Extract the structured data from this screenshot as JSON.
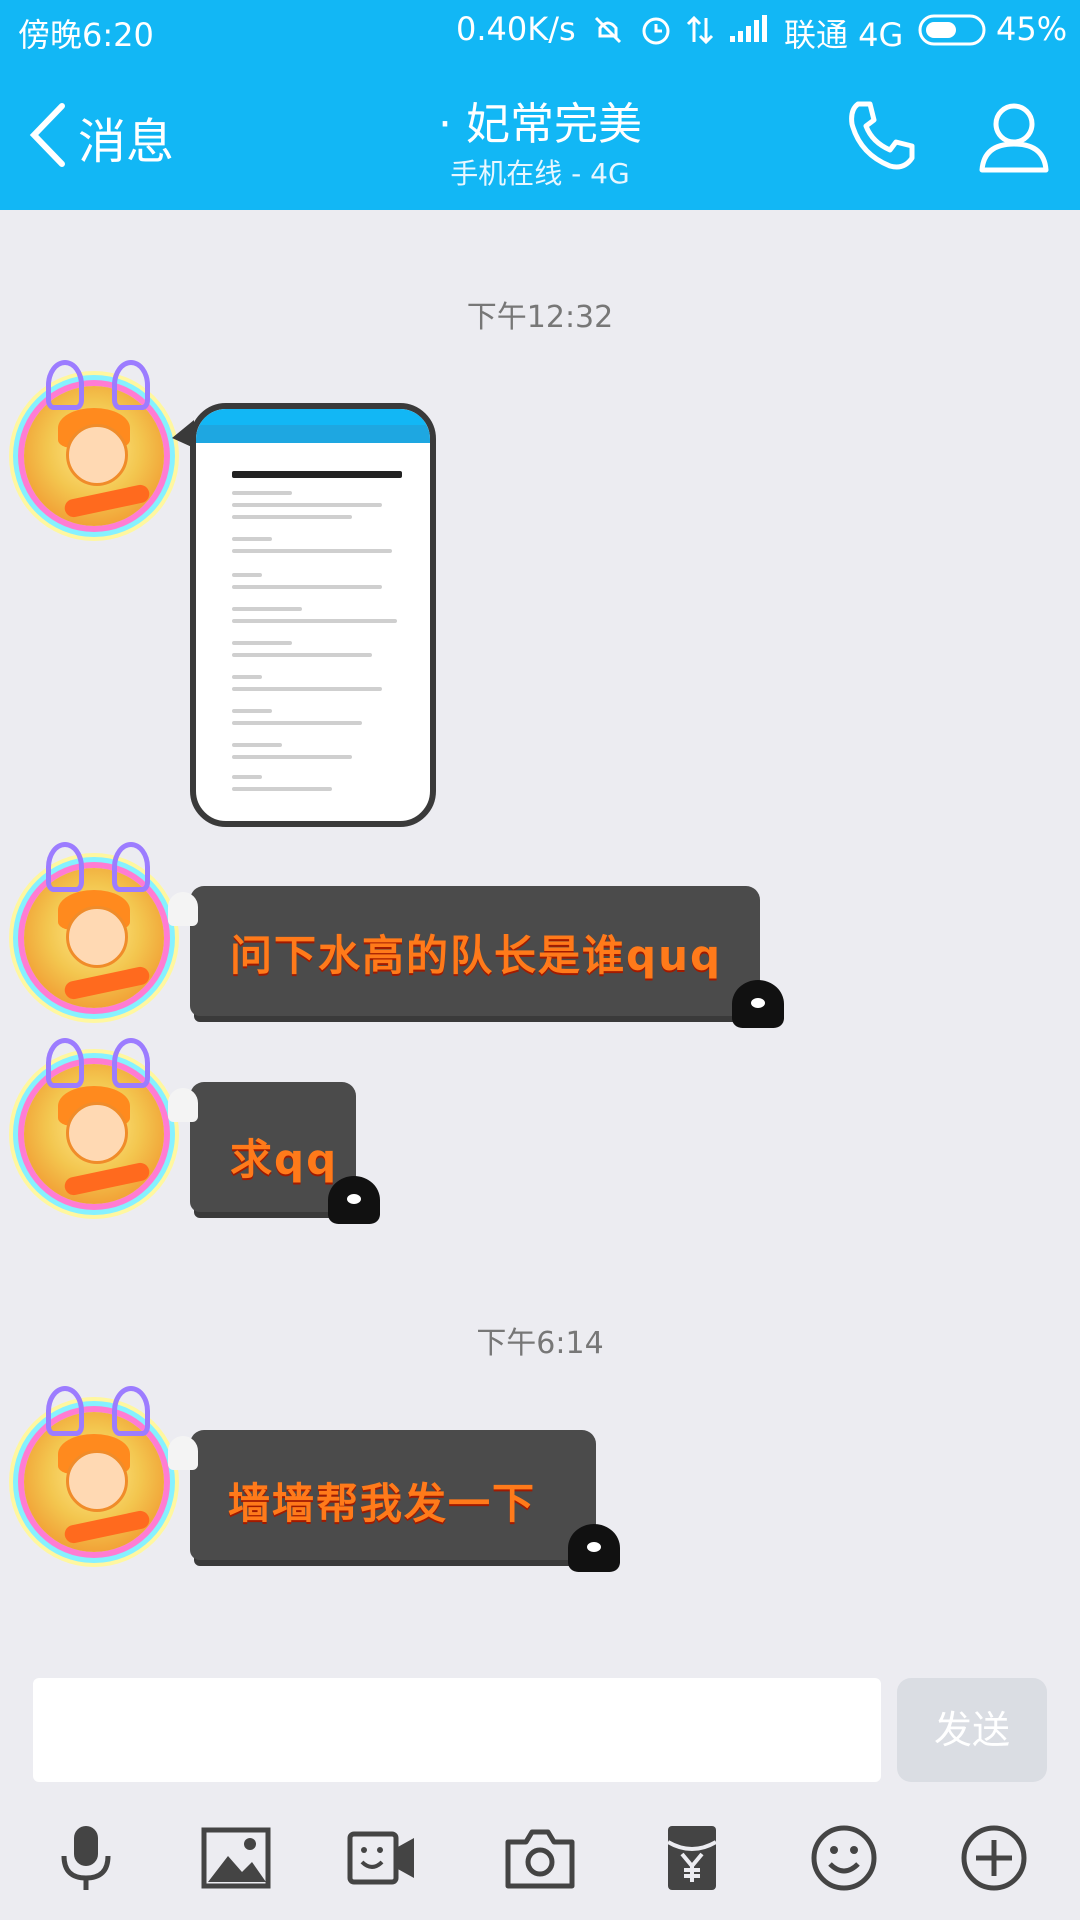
{
  "status_bar": {
    "time": "傍晚6:20",
    "net_speed": "0.40K/s",
    "carrier": "联通 4G",
    "battery": "45%"
  },
  "header": {
    "back_label": "消息",
    "title": "· 妃常完美",
    "subtitle": "手机在线 - 4G"
  },
  "timestamps": [
    "下午12:32",
    "下午6:14"
  ],
  "messages": [
    {
      "type": "image",
      "text": ""
    },
    {
      "type": "text",
      "text": "问下水高的队长是谁quq"
    },
    {
      "type": "text",
      "text": "求qq"
    },
    {
      "type": "text",
      "text": "墙墙帮我发一下"
    }
  ],
  "input": {
    "placeholder": "",
    "send_label": "发送"
  },
  "toolbar": {
    "items": [
      "microphone-icon",
      "image-icon",
      "video-call-icon",
      "camera-icon",
      "red-packet-icon",
      "emoji-icon",
      "plus-icon"
    ]
  },
  "colors": {
    "brand": "#12b7f5",
    "bubble": "#4b4b4b",
    "bubble_text": "#ff7a1a"
  }
}
